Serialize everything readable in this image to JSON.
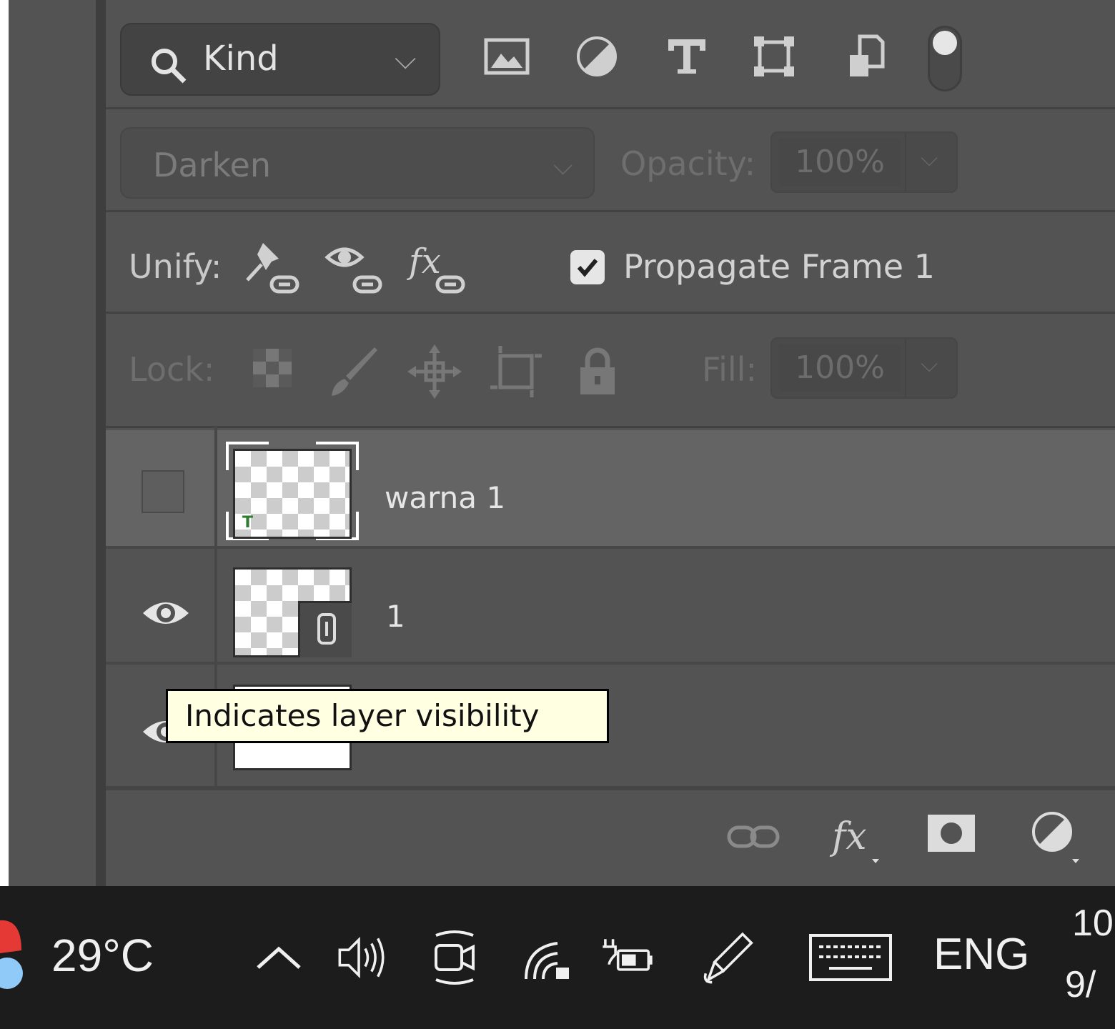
{
  "filter": {
    "kind_label": "Kind",
    "kind_chevron": "⌵",
    "icons": [
      "pixel-layer-filter-icon",
      "adjustment-layer-filter-icon",
      "type-layer-filter-icon",
      "shape-layer-filter-icon",
      "smart-object-filter-icon",
      "filter-toggle-icon"
    ]
  },
  "blend": {
    "mode": "Darken",
    "chevron": "⌵",
    "opacity_label": "Opacity:",
    "opacity_value": "100%"
  },
  "unify": {
    "label": "Unify:",
    "icons": [
      "unify-position-icon",
      "unify-visibility-icon",
      "unify-style-icon"
    ],
    "propagate_label": "Propagate Frame 1",
    "propagate_checked": true
  },
  "lock": {
    "label": "Lock:",
    "icons": [
      "lock-transparent-pixels-icon",
      "lock-image-pixels-icon",
      "lock-position-icon",
      "lock-artboard-icon",
      "lock-all-icon"
    ],
    "fill_label": "Fill:",
    "fill_value": "100%"
  },
  "layers": [
    {
      "name": "warna 1",
      "visible": false,
      "selected": true
    },
    {
      "name": "1",
      "visible": true,
      "selected": false
    },
    {
      "name": "",
      "visible": true,
      "selected": false
    }
  ],
  "tooltip": "Indicates layer visibility",
  "bottom_bar": {
    "icons": [
      "link-layers-icon",
      "layer-style-fx-icon",
      "add-mask-icon",
      "new-adjustment-layer-icon"
    ]
  },
  "taskbar": {
    "temperature": "29°C",
    "language": "ENG",
    "time": "10",
    "date": "9/",
    "icons": [
      "chevron-up-icon",
      "volume-icon",
      "camera-icon",
      "wifi-icon",
      "battery-icon",
      "pen-icon",
      "keyboard-icon"
    ]
  }
}
